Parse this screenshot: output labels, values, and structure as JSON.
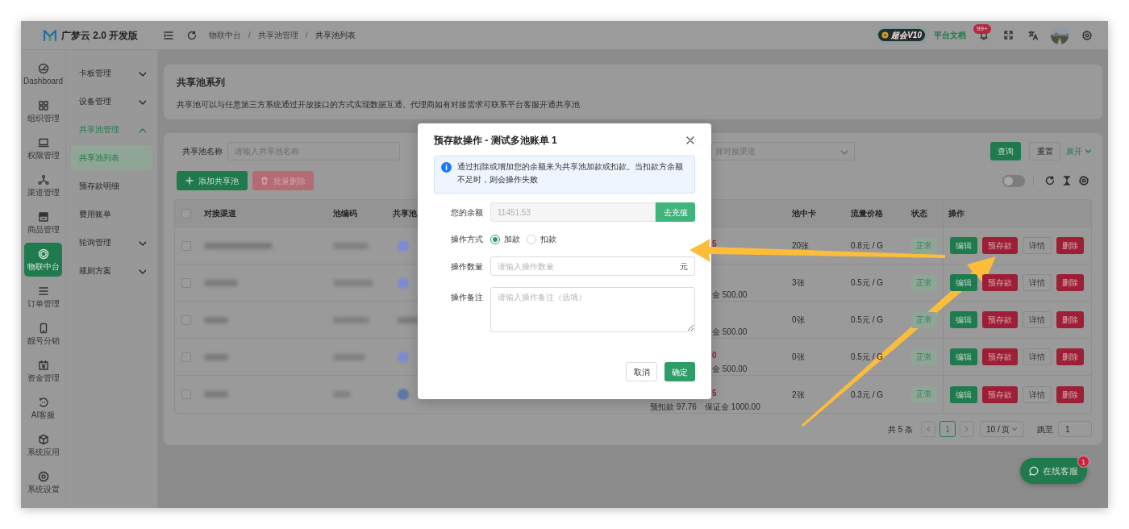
{
  "header": {
    "logo_text": "广梦云 2.0 开发版",
    "breadcrumb": [
      "物联中台",
      "共享池管理",
      "共享池列表"
    ],
    "breadcrumb_separator": "/",
    "vip_badge": "超会V10",
    "docs_link": "平台文档",
    "notification_count": "99+"
  },
  "rail": [
    {
      "label": "Dashboard",
      "selected": false
    },
    {
      "label": "组织管理",
      "selected": false
    },
    {
      "label": "权限管理",
      "selected": false
    },
    {
      "label": "渠道管理",
      "selected": false
    },
    {
      "label": "商品管理",
      "selected": false
    },
    {
      "label": "物联中台",
      "selected": true
    },
    {
      "label": "订单管理",
      "selected": false
    },
    {
      "label": "靓号分销",
      "selected": false
    },
    {
      "label": "资金管理",
      "selected": false
    },
    {
      "label": "AI客服",
      "selected": false
    },
    {
      "label": "系统应用",
      "selected": false
    },
    {
      "label": "系统设置",
      "selected": false
    }
  ],
  "submenu": [
    {
      "label": "卡板管理",
      "expanded": false
    },
    {
      "label": "设备管理",
      "expanded": false
    },
    {
      "label": "共享池管理",
      "expanded": true,
      "children": [
        {
          "label": "共享池列表",
          "selected": true
        },
        {
          "label": "预存款明细",
          "selected": false
        },
        {
          "label": "费用账单",
          "selected": false
        }
      ]
    },
    {
      "label": "轮询管理",
      "expanded": false
    },
    {
      "label": "规则方案",
      "expanded": false
    }
  ],
  "page": {
    "title": "共享池系列",
    "description": "共享池可以与任意第三方系统通过开放接口的方式实现数据互通。代理商如有对接需求可联系平台客服开通共享池"
  },
  "filters": {
    "name_label": "共享池名称",
    "name_placeholder": "请输入共享池名称",
    "channel_placeholder": "择对接渠道",
    "search": "查询",
    "reset": "重置",
    "expand": "展开"
  },
  "actions": {
    "add": "添加共享池",
    "batch_delete": {
      "label": "批量删除",
      "disabled": true
    }
  },
  "toolbar": {
    "toggle_on": false
  },
  "table": {
    "select_all_checked": false,
    "columns": [
      "对接渠道",
      "池编码",
      "共享池",
      "池中卡",
      "流量价格",
      "状态",
      "操作"
    ],
    "rows": [
      {
        "checked": false,
        "pool_avatar": true,
        "amount": "5",
        "cards": "20张",
        "price": "0.8元 / G",
        "status": "正常",
        "actions": [
          {
            "label": "编辑",
            "kind": "edit"
          },
          {
            "label": "预存款",
            "kind": "deposit"
          },
          {
            "label": "详情",
            "kind": "detail"
          },
          {
            "label": "删除",
            "kind": "delete"
          }
        ]
      },
      {
        "checked": false,
        "pool_avatar": true,
        "note": "金 500.00",
        "cards": "3张",
        "price": "0.5元 / G",
        "status": "正常",
        "actions": [
          {
            "label": "编辑",
            "kind": "edit"
          },
          {
            "label": "预存款",
            "kind": "deposit"
          },
          {
            "label": "详情",
            "kind": "detail"
          },
          {
            "label": "删除",
            "kind": "delete"
          }
        ]
      },
      {
        "checked": false,
        "pool_avatar": false,
        "note": "金 500.00",
        "cards": "0张",
        "price": "0.5元 / G",
        "status": "正常",
        "actions": [
          {
            "label": "编辑",
            "kind": "edit"
          },
          {
            "label": "预存款",
            "kind": "deposit"
          },
          {
            "label": "详情",
            "kind": "detail"
          },
          {
            "label": "删除",
            "kind": "delete"
          }
        ]
      },
      {
        "checked": false,
        "pool_avatar": true,
        "amount": "0",
        "note": "金 500.00",
        "cards": "0张",
        "price": "0.5元 / G",
        "status": "正常",
        "actions": [
          {
            "label": "编辑",
            "kind": "edit"
          },
          {
            "label": "预存款",
            "kind": "deposit"
          },
          {
            "label": "详情",
            "kind": "detail"
          },
          {
            "label": "删除",
            "kind": "delete"
          }
        ]
      },
      {
        "checked": false,
        "pool_avatar": true,
        "amount": "5",
        "deposit_note": "预扣款 97.76",
        "note": "保证金 1000.00",
        "cards": "2张",
        "price": "0.3元 / G",
        "status": "正常",
        "actions": [
          {
            "label": "编辑",
            "kind": "edit"
          },
          {
            "label": "预存款",
            "kind": "deposit"
          },
          {
            "label": "详情",
            "kind": "detail"
          },
          {
            "label": "删除",
            "kind": "delete"
          }
        ]
      }
    ]
  },
  "pagination": {
    "total": "共 5 条",
    "pages": [
      {
        "label": "1",
        "selected": true
      }
    ],
    "page_size": "10 / 页",
    "jump_label": "跳至",
    "jump_value": "1"
  },
  "modal": {
    "title": "预存款操作 - 测试多池账单 1",
    "info": "通过扣除或增加您的余额来为共享池加款或扣款。当扣款方余额不足时，则会操作失败",
    "balance_label": "您的余额",
    "balance_value": "11451.53",
    "recharge": "去充值",
    "mode_label": "操作方式",
    "modes": [
      {
        "label": "加款",
        "selected": true
      },
      {
        "label": "扣款",
        "selected": false
      }
    ],
    "amount_label": "操作数量",
    "amount_placeholder": "请输入操作数量",
    "amount_unit": "元",
    "remark_label": "操作备注",
    "remark_placeholder": "请输入操作备注（选填）",
    "cancel": "取消",
    "confirm": "确定"
  },
  "chat": {
    "label": "在线客服",
    "badge": "1"
  }
}
